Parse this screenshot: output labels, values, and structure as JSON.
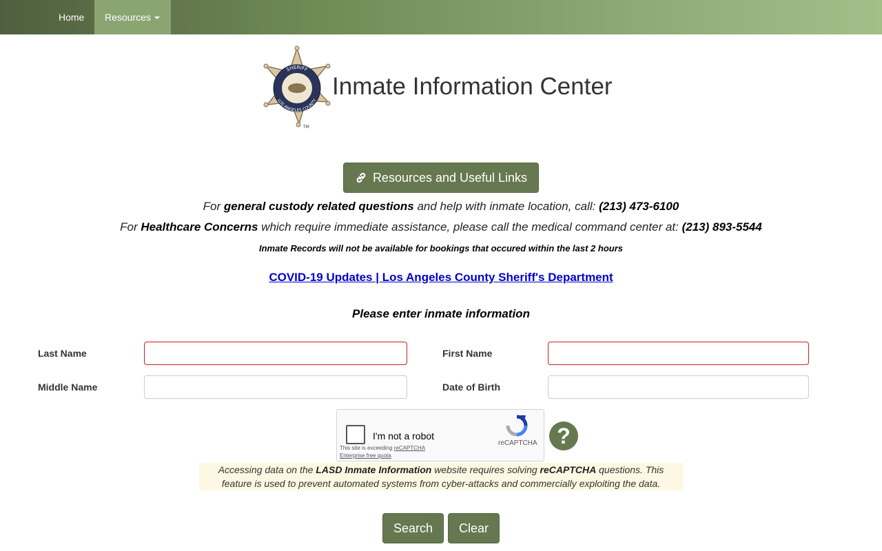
{
  "nav": {
    "home": "Home",
    "resources": "Resources"
  },
  "header": {
    "title": "Inmate Information Center"
  },
  "resources_button": "Resources and Useful Links",
  "info": {
    "line1_a": "For ",
    "line1_b": "general custody related questions",
    "line1_c": " and help with inmate location, call: ",
    "line1_phone": "(213) 473-6100",
    "line2_a": "For ",
    "line2_b": "Healthcare Concerns",
    "line2_c": " which require immediate assistance, please call the medical command center at: ",
    "line2_phone": "(213) 893-5544",
    "notice": "Inmate Records will not be available for bookings that occured within the last 2 hours",
    "covid_link": "COVID-19 Updates | Los Angeles County Sheriff's Department",
    "prompt": "Please enter inmate information"
  },
  "form": {
    "last_name_label": "Last Name",
    "first_name_label": "First Name",
    "middle_name_label": "Middle Name",
    "dob_label": "Date of Birth",
    "last_name_value": "",
    "first_name_value": "",
    "middle_name_value": "",
    "dob_value": ""
  },
  "captcha": {
    "label": "I'm not a robot",
    "brand": "reCAPTCHA",
    "warning_a": "This site is exceeding ",
    "warning_b": "reCAPTCHA Enterprise free quota",
    "warning_c": "."
  },
  "help_icon_glyph": "?",
  "disclaimer": {
    "a": "Accessing data on the ",
    "b": "LASD Inmate Information",
    "c": " website requires solving ",
    "d": "reCAPTCHA",
    "e": " questions. This feature is used to prevent automated systems from cyber-attacks and commercially exploiting the data."
  },
  "buttons": {
    "search": "Search",
    "clear": "Clear"
  },
  "colors": {
    "accent": "#66784f",
    "required_border": "#cc1f1f",
    "link": "#0000cc",
    "disclaimer_bg": "#fcf8e3"
  },
  "logo": {
    "top_text": "SHERIFF",
    "bottom_text": "LOS ANGELES COUNTY",
    "tm": "TM"
  },
  "icons": {
    "link": "link-icon",
    "captcha": "recaptcha-icon",
    "help": "question-icon",
    "caret": "caret-down-icon"
  }
}
